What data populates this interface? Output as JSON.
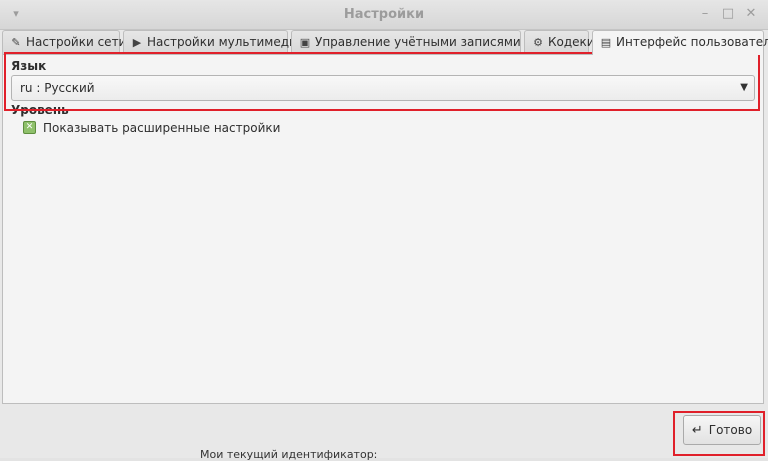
{
  "window": {
    "title": "Настройки",
    "menu_glyph": "▾",
    "minimize_glyph": "–",
    "maximize_glyph": "□",
    "close_glyph": "✕"
  },
  "tabs": [
    {
      "label": "Настройки сети",
      "icon": "network-wrench-icon",
      "glyph": "✎"
    },
    {
      "label": "Настройки мультимедиа",
      "icon": "play-icon",
      "glyph": "▶"
    },
    {
      "label": "Управление учётными записями SIP",
      "icon": "accounts-icon",
      "glyph": "▣"
    },
    {
      "label": "Кодеки",
      "icon": "gear-icon",
      "glyph": "⚙"
    },
    {
      "label": "Интерфейс пользователя",
      "icon": "document-icon",
      "glyph": "▤",
      "active": true
    }
  ],
  "language": {
    "group_label": "Язык",
    "selected": "ru : Русский",
    "arrow_glyph": "▼"
  },
  "level": {
    "group_label": "Уровень",
    "checkbox_label": "Показывать расширенные настройки",
    "checked": true,
    "check_glyph": "✕"
  },
  "footer": {
    "ok_label": "Готово",
    "ok_glyph": "↵"
  },
  "background_text": "Мои текущий идентификатор:",
  "colors": {
    "highlight": "#e0202a",
    "checkbox": "#8fc06b"
  }
}
